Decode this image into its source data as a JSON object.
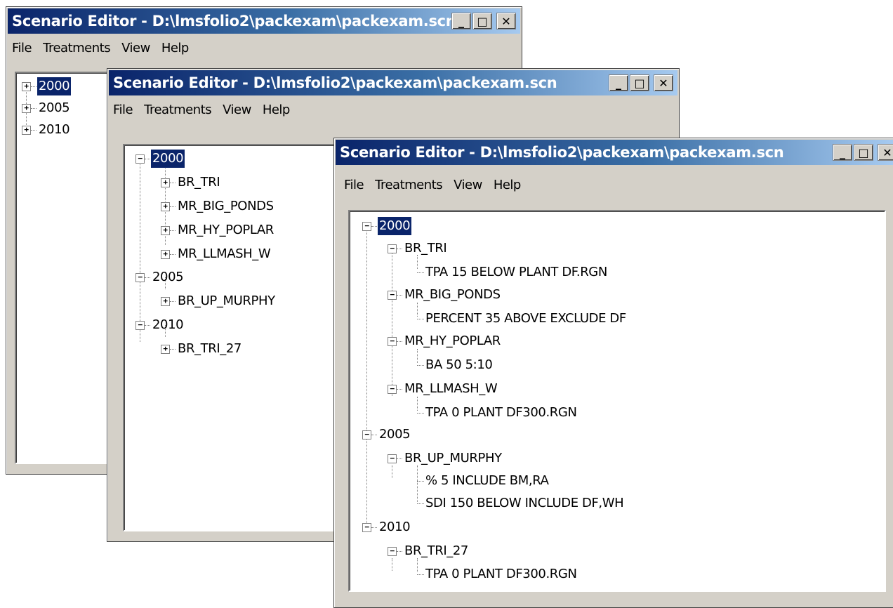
{
  "window": {
    "title": "Scenario Editor - D:\\lmsfolio2\\packexam\\packexam.scn",
    "minimize": "_",
    "maximize": "□",
    "close": "✕"
  },
  "menu": {
    "file": "File",
    "treatments": "Treatments",
    "view": "View",
    "help": "Help"
  },
  "tree": {
    "y2000": "2000",
    "y2005": "2005",
    "y2010": "2010",
    "br_tri": "BR_TRI",
    "mr_big_ponds": "MR_BIG_PONDS",
    "mr_hy_poplar": "MR_HY_POPLAR",
    "mr_llmash_w": "MR_LLMASH_W",
    "br_up_murphy": "BR_UP_MURPHY",
    "br_tri_27": "BR_TRI_27",
    "t_br_tri": "TPA 15 BELOW PLANT DF.RGN",
    "t_big_ponds": "PERCENT 35 ABOVE EXCLUDE DF",
    "t_hy_poplar": "BA 50 5:10",
    "t_llmash": "TPA 0 PLANT DF300.RGN",
    "t_murphy_1": "% 5 INCLUDE BM,RA",
    "t_murphy_2": "SDI 150 BELOW INCLUDE DF,WH",
    "t_tri_27": "TPA 0 PLANT DF300.RGN"
  },
  "expander": {
    "plus": "+",
    "minus": "−"
  }
}
